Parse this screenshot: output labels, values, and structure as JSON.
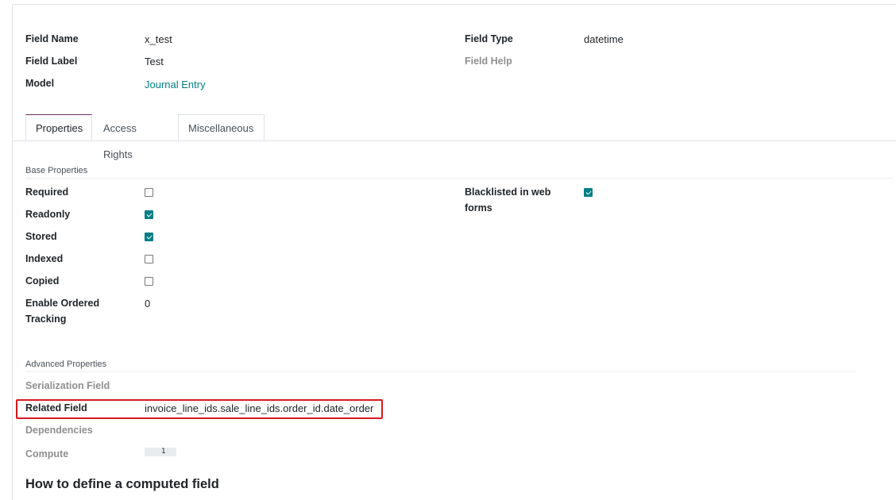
{
  "header_fields": {
    "field_name_label": "Field Name",
    "field_name_value": "x_test",
    "field_label_label": "Field Label",
    "field_label_value": "Test",
    "model_label": "Model",
    "model_value": "Journal Entry",
    "field_type_label": "Field Type",
    "field_type_value": "datetime",
    "field_help_label": "Field Help"
  },
  "tabs": [
    {
      "label": "Properties",
      "active": true
    },
    {
      "label": "Access Rights",
      "active": false
    },
    {
      "label": "Miscellaneous",
      "active": false
    }
  ],
  "base_properties": {
    "title": "Base Properties",
    "required_label": "Required",
    "required_checked": false,
    "readonly_label": "Readonly",
    "readonly_checked": true,
    "stored_label": "Stored",
    "stored_checked": true,
    "indexed_label": "Indexed",
    "indexed_checked": false,
    "copied_label": "Copied",
    "copied_checked": false,
    "ordered_tracking_label_1": "Enable Ordered",
    "ordered_tracking_label_2": "Tracking",
    "ordered_tracking_value": "0",
    "blacklisted_label_1": "Blacklisted in web",
    "blacklisted_label_2": "forms",
    "blacklisted_checked": true
  },
  "advanced_properties": {
    "title": "Advanced Properties",
    "serialization_label": "Serialization Field",
    "related_label": "Related Field",
    "related_value": "invoice_line_ids.sale_line_ids.order_id.date_order",
    "dependencies_label": "Dependencies",
    "compute_label": "Compute",
    "compute_value": "1"
  },
  "help_heading": "How to define a computed field",
  "colors": {
    "accent": "#017e84",
    "highlight_border": "#d9181f",
    "active_tab_top": "#6c2f5f"
  }
}
